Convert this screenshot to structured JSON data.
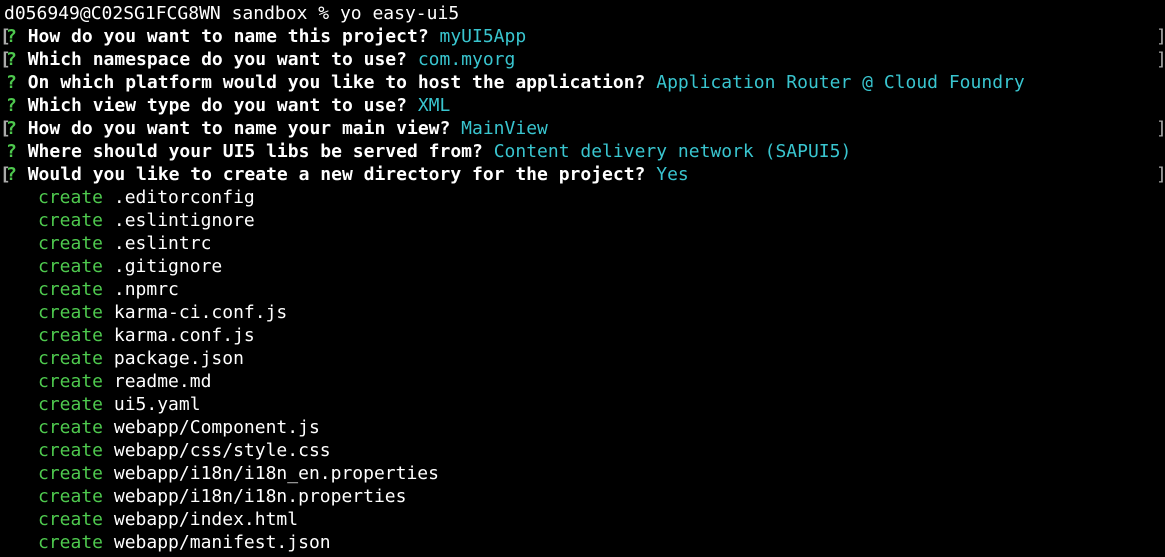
{
  "terminal": {
    "prompt": "d056949@C02SG1FCG8WN sandbox % yo easy-ui5",
    "questions": [
      {
        "mark": "?",
        "text": "How do you want to name this project?",
        "answer": "myUI5App"
      },
      {
        "mark": "?",
        "text": "Which namespace do you want to use?",
        "answer": "com.myorg"
      },
      {
        "mark": "?",
        "text": "On which platform would you like to host the application?",
        "answer": "Application Router @ Cloud Foundry"
      },
      {
        "mark": "?",
        "text": "Which view type do you want to use?",
        "answer": "XML"
      },
      {
        "mark": "?",
        "text": "How do you want to name your main view?",
        "answer": "MainView"
      },
      {
        "mark": "?",
        "text": "Where should your UI5 libs be served from?",
        "answer": "Content delivery network (SAPUI5)"
      },
      {
        "mark": "?",
        "text": "Would you like to create a new directory for the project?",
        "answer": "Yes"
      }
    ],
    "create_label": "create",
    "created_files": [
      ".editorconfig",
      ".eslintignore",
      ".eslintrc",
      ".gitignore",
      ".npmrc",
      "karma-ci.conf.js",
      "karma.conf.js",
      "package.json",
      "readme.md",
      "ui5.yaml",
      "webapp/Component.js",
      "webapp/css/style.css",
      "webapp/i18n/i18n_en.properties",
      "webapp/i18n/i18n.properties",
      "webapp/index.html",
      "webapp/manifest.json"
    ],
    "colors": {
      "background": "#000000",
      "text": "#ffffff",
      "prompt_mark": "#4ec94e",
      "answer": "#39c5cf",
      "create": "#4ec94e"
    }
  }
}
